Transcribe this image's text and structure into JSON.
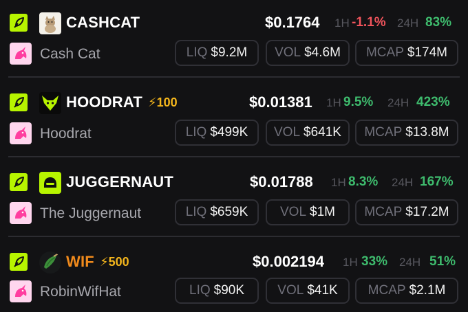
{
  "colors": {
    "positive": "#3ebb6d",
    "negative": "#f1545c",
    "boost": "#f3b51c",
    "chain_badge": "#b7f400",
    "wif_ticker": "#f08a1c"
  },
  "labels": {
    "h1": "1H",
    "h24": "24H",
    "liq": "LIQ",
    "vol": "VOL",
    "mcap": "MCAP"
  },
  "icons": {
    "chain": "leaf-icon",
    "dex": "unicorn-icon",
    "boost": "lightning-icon"
  },
  "tokens": [
    {
      "ticker": "CASHCAT",
      "name": "Cash Cat",
      "boost": "",
      "price": "$0.1764",
      "change_1h": "-1.1%",
      "change_24h": "83%",
      "liq": "$9.2M",
      "vol": "$4.6M",
      "mcap": "$174M",
      "avatar_icon": "cat-avatar-icon"
    },
    {
      "ticker": "HOODRAT",
      "name": "Hoodrat",
      "boost": "100",
      "price": "$0.01381",
      "change_1h": "9.5%",
      "change_24h": "423%",
      "liq": "$499K",
      "vol": "$641K",
      "mcap": "$13.8M",
      "avatar_icon": "rat-avatar-icon"
    },
    {
      "ticker": "JUGGERNAUT",
      "name": "The Juggernaut",
      "boost": "",
      "price": "$0.01788",
      "change_1h": "8.3%",
      "change_24h": "167%",
      "liq": "$659K",
      "vol": "$1M",
      "mcap": "$17.2M",
      "avatar_icon": "helmet-avatar-icon"
    },
    {
      "ticker": "WIF",
      "name": "RobinWifHat",
      "boost": "500",
      "price": "$0.002194",
      "change_1h": "33%",
      "change_24h": "51%",
      "liq": "$90K",
      "vol": "$41K",
      "mcap": "$2.1M",
      "avatar_icon": "robin-hat-avatar-icon"
    }
  ]
}
